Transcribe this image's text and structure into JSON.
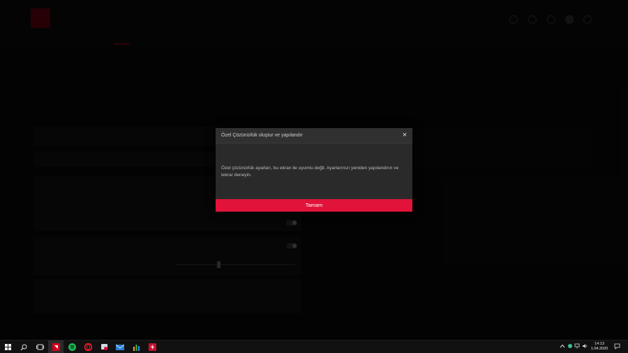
{
  "modal": {
    "title": "Özel Çözünürlük oluştur ve yapılandır",
    "close_symbol": "×",
    "message": "Özel çözünürlük ayarları, bu ekran ile uyumlu değil. Ayarlarınızı yeniden yapılandırın ve tekrar deneyin.",
    "ok_label": "Tamam",
    "button_color": "#e1133b"
  },
  "taskbar": {
    "time": "14:13",
    "date": "1.04.2020",
    "apps": [
      "windows-start-icon",
      "search-icon",
      "task-view-icon",
      "amd-radeon-icon",
      "spotify-icon",
      "opera-icon",
      "photos-icon",
      "mail-icon",
      "chart-app-icon",
      "flash-app-icon"
    ],
    "tray_icons": [
      "chevron-up-icon",
      "status-dot-icon",
      "network-icon",
      "volume-icon",
      "notification-icon"
    ]
  },
  "accent_color": "#e0002a"
}
